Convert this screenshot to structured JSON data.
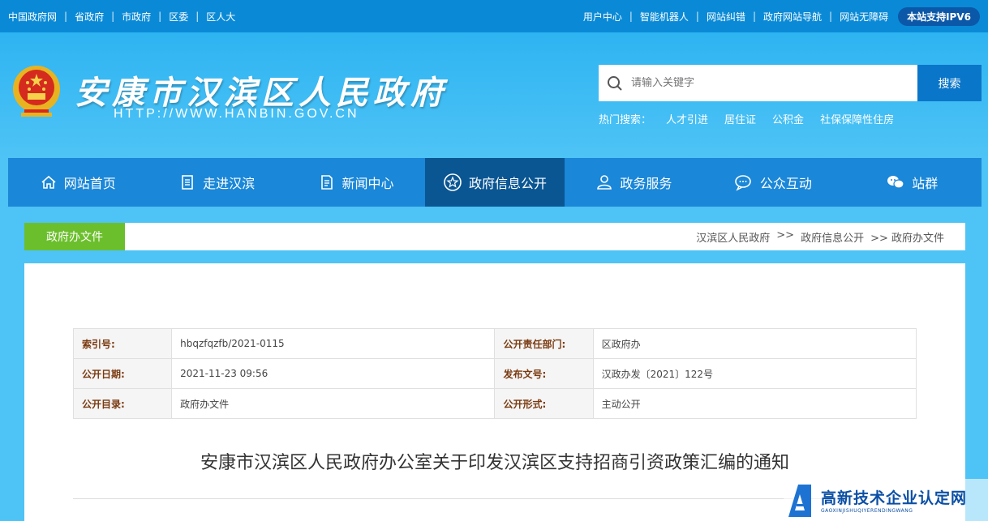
{
  "topbar": {
    "left_links": [
      "中国政府网",
      "省政府",
      "市政府",
      "区委",
      "区人大"
    ],
    "right_links": [
      "用户中心",
      "智能机器人",
      "网站纠错",
      "政府网站导航",
      "网站无障碍"
    ],
    "ipv6": "本站支持IPV6"
  },
  "header": {
    "title": "安康市汉滨区人民政府",
    "url": "HTTP://WWW.HANBIN.GOV.CN",
    "search_placeholder": "请输入关键字",
    "search_button": "搜索",
    "hot_label": "热门搜索：",
    "hot_items": [
      "人才引进",
      "居住证",
      "公积金",
      "社保保障性住房"
    ]
  },
  "nav": {
    "items": [
      {
        "label": "网站首页",
        "icon": "home-icon"
      },
      {
        "label": "走进汉滨",
        "icon": "document-icon"
      },
      {
        "label": "新闻中心",
        "icon": "news-icon"
      },
      {
        "label": "政府信息公开",
        "icon": "star-icon"
      },
      {
        "label": "政务服务",
        "icon": "person-icon"
      },
      {
        "label": "公众互动",
        "icon": "chat-icon"
      },
      {
        "label": "站群",
        "icon": "wechat-icon"
      }
    ],
    "active_index": 3
  },
  "breadcrumb": {
    "section": "政府办文件",
    "items": [
      "汉滨区人民政府",
      ">>",
      "政府信息公开",
      ">> 政府办文件"
    ]
  },
  "meta": {
    "index_label": "索引号:",
    "index_value": "hbqzfqzfb/2021-0115",
    "dept_label": "公开责任部门:",
    "dept_value": "区政府办",
    "date_label": "公开日期:",
    "date_value": "2021-11-23 09:56",
    "docno_label": "发布文号:",
    "docno_value": "汉政办发〔2021〕122号",
    "catalog_label": "公开目录:",
    "catalog_value": "政府办文件",
    "form_label": "公开形式:",
    "form_value": "主动公开"
  },
  "document": {
    "title": "安康市汉滨区人民政府办公室关于印发汉滨区支持招商引资政策汇编的通知"
  },
  "watermark": {
    "main": "高新技术企业认定网",
    "sub": "GAOXINJISHUQIYERENDINGWANG"
  },
  "colors": {
    "topbar": "#0a8ad6",
    "header": "#4ec3f5",
    "nav": "#1a87d8",
    "nav_active": "#0a5693",
    "section_tag": "#6cbf2c"
  }
}
